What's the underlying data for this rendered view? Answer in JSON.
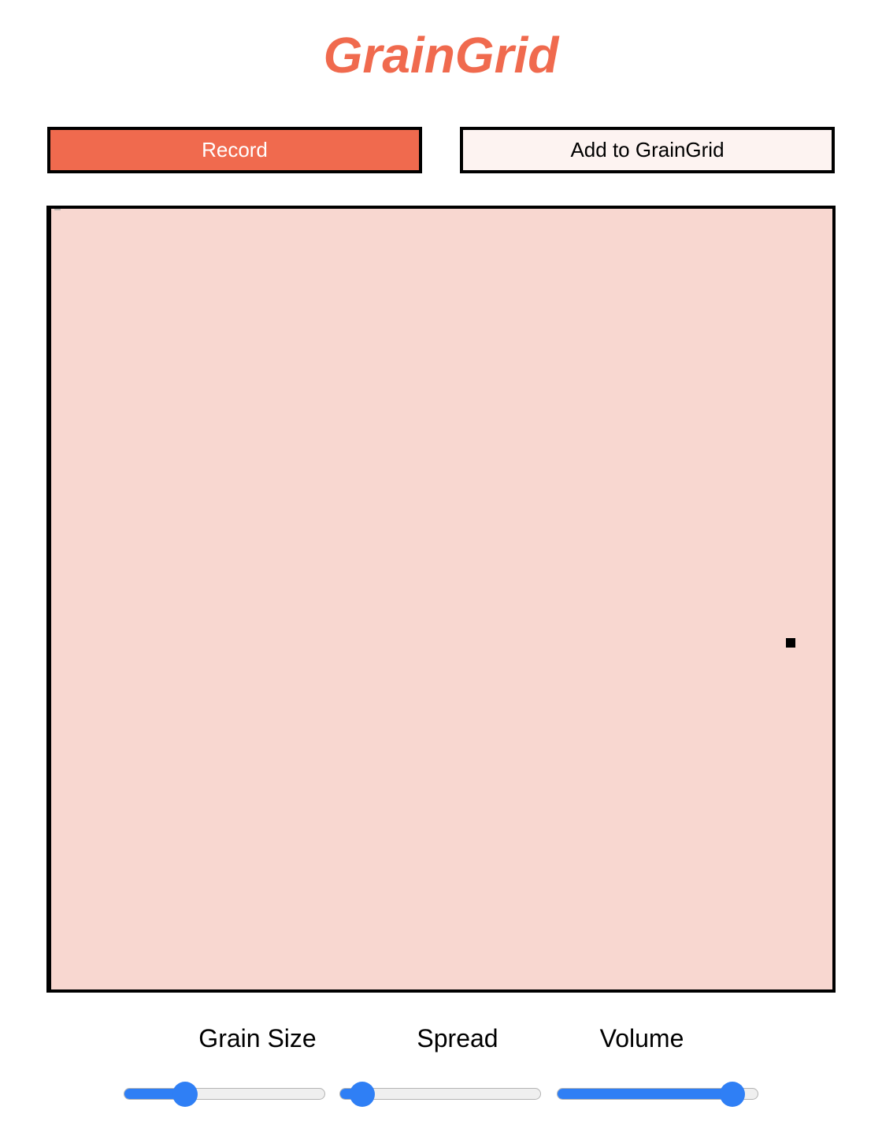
{
  "app": {
    "title": "GrainGrid"
  },
  "colors": {
    "accent": "#f06a4e",
    "add_button_bg": "#fdf3f1",
    "canvas_bg": "#f8d7d0",
    "slider_accent": "#2f7ff5"
  },
  "controls": {
    "record_label": "Record",
    "add_label": "Add to GrainGrid"
  },
  "sliders": [
    {
      "label": "Grain Size",
      "value": 0.28
    },
    {
      "label": "Spread",
      "value": 0.06
    },
    {
      "label": "Volume",
      "value": 0.94
    }
  ]
}
